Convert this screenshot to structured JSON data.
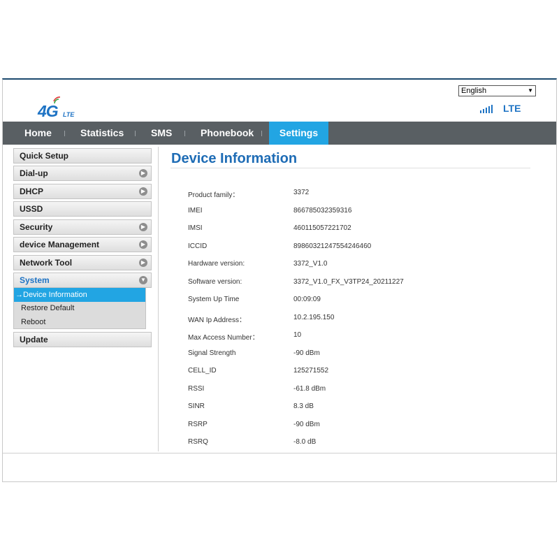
{
  "header": {
    "logo_text": "4G",
    "logo_sub": "LTE",
    "language": "English",
    "network_type": "LTE"
  },
  "nav": {
    "items": [
      "Home",
      "Statistics",
      "SMS",
      "Phonebook",
      "Settings"
    ],
    "active": "Settings"
  },
  "sidebar": {
    "items": [
      {
        "label": "Quick Setup",
        "expandable": false
      },
      {
        "label": "Dial-up",
        "expandable": true
      },
      {
        "label": "DHCP",
        "expandable": true
      },
      {
        "label": "USSD",
        "expandable": false
      },
      {
        "label": "Security",
        "expandable": true
      },
      {
        "label": "device Management",
        "expandable": true
      },
      {
        "label": "Network Tool",
        "expandable": true
      },
      {
        "label": "System",
        "expandable": true,
        "open": true
      },
      {
        "label": "Update",
        "expandable": false
      }
    ],
    "system_submenu": [
      "→Device Information",
      "Restore Default",
      "Reboot"
    ]
  },
  "main": {
    "title": "Device Information",
    "rows": [
      {
        "label": "Product family：",
        "value": "3372"
      },
      {
        "label": "IMEI",
        "value": "866785032359316"
      },
      {
        "label": "IMSI",
        "value": "460115057221702"
      },
      {
        "label": "ICCID",
        "value": "89860321247554246460"
      },
      {
        "label": "Hardware version:",
        "value": "3372_V1.0"
      },
      {
        "label": "Software version:",
        "value": "3372_V1.0_FX_V3TP24_20211227"
      },
      {
        "label": "System Up Time",
        "value": "00:09:09"
      },
      {
        "label": "WAN Ip Address：",
        "value": "10.2.195.150"
      },
      {
        "label": "Max Access Number：",
        "value": "10"
      },
      {
        "label": "Signal Strength",
        "value": "-90 dBm"
      },
      {
        "label": "CELL_ID",
        "value": "125271552"
      },
      {
        "label": "RSSI",
        "value": "-61.8 dBm"
      },
      {
        "label": "SINR",
        "value": "8.3 dB"
      },
      {
        "label": "RSRP",
        "value": "-90 dBm"
      },
      {
        "label": "RSRQ",
        "value": "-8.0 dB"
      }
    ]
  },
  "colors": {
    "accent": "#22a5e3",
    "brand": "#1e6cb5",
    "nav_bg": "#595f63"
  }
}
